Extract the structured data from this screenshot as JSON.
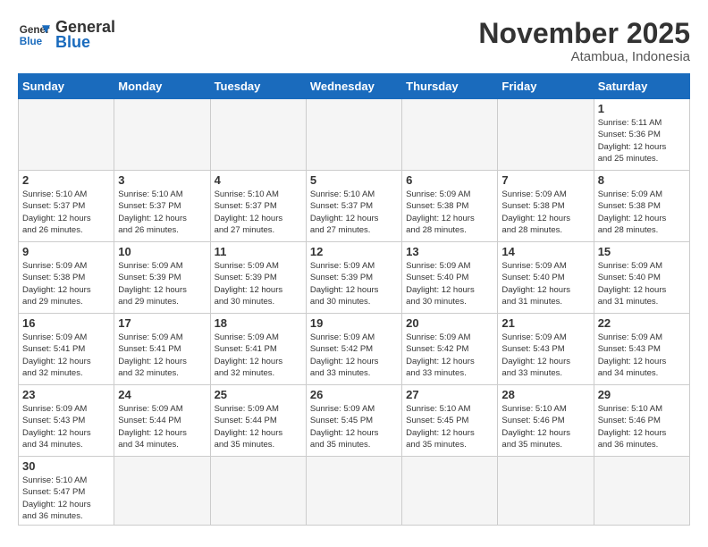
{
  "logo": {
    "text_general": "General",
    "text_blue": "Blue"
  },
  "title": "November 2025",
  "subtitle": "Atambua, Indonesia",
  "weekdays": [
    "Sunday",
    "Monday",
    "Tuesday",
    "Wednesday",
    "Thursday",
    "Friday",
    "Saturday"
  ],
  "weeks": [
    [
      {
        "day": "",
        "empty": true
      },
      {
        "day": "",
        "empty": true
      },
      {
        "day": "",
        "empty": true
      },
      {
        "day": "",
        "empty": true
      },
      {
        "day": "",
        "empty": true
      },
      {
        "day": "",
        "empty": true
      },
      {
        "day": "1",
        "sunrise": "5:11 AM",
        "sunset": "5:36 PM",
        "daylight": "12 hours and 25 minutes."
      }
    ],
    [
      {
        "day": "2",
        "sunrise": "5:10 AM",
        "sunset": "5:37 PM",
        "daylight": "12 hours and 26 minutes."
      },
      {
        "day": "3",
        "sunrise": "5:10 AM",
        "sunset": "5:37 PM",
        "daylight": "12 hours and 26 minutes."
      },
      {
        "day": "4",
        "sunrise": "5:10 AM",
        "sunset": "5:37 PM",
        "daylight": "12 hours and 27 minutes."
      },
      {
        "day": "5",
        "sunrise": "5:10 AM",
        "sunset": "5:37 PM",
        "daylight": "12 hours and 27 minutes."
      },
      {
        "day": "6",
        "sunrise": "5:09 AM",
        "sunset": "5:38 PM",
        "daylight": "12 hours and 28 minutes."
      },
      {
        "day": "7",
        "sunrise": "5:09 AM",
        "sunset": "5:38 PM",
        "daylight": "12 hours and 28 minutes."
      },
      {
        "day": "8",
        "sunrise": "5:09 AM",
        "sunset": "5:38 PM",
        "daylight": "12 hours and 28 minutes."
      }
    ],
    [
      {
        "day": "9",
        "sunrise": "5:09 AM",
        "sunset": "5:38 PM",
        "daylight": "12 hours and 29 minutes."
      },
      {
        "day": "10",
        "sunrise": "5:09 AM",
        "sunset": "5:39 PM",
        "daylight": "12 hours and 29 minutes."
      },
      {
        "day": "11",
        "sunrise": "5:09 AM",
        "sunset": "5:39 PM",
        "daylight": "12 hours and 30 minutes."
      },
      {
        "day": "12",
        "sunrise": "5:09 AM",
        "sunset": "5:39 PM",
        "daylight": "12 hours and 30 minutes."
      },
      {
        "day": "13",
        "sunrise": "5:09 AM",
        "sunset": "5:40 PM",
        "daylight": "12 hours and 30 minutes."
      },
      {
        "day": "14",
        "sunrise": "5:09 AM",
        "sunset": "5:40 PM",
        "daylight": "12 hours and 31 minutes."
      },
      {
        "day": "15",
        "sunrise": "5:09 AM",
        "sunset": "5:40 PM",
        "daylight": "12 hours and 31 minutes."
      }
    ],
    [
      {
        "day": "16",
        "sunrise": "5:09 AM",
        "sunset": "5:41 PM",
        "daylight": "12 hours and 32 minutes."
      },
      {
        "day": "17",
        "sunrise": "5:09 AM",
        "sunset": "5:41 PM",
        "daylight": "12 hours and 32 minutes."
      },
      {
        "day": "18",
        "sunrise": "5:09 AM",
        "sunset": "5:41 PM",
        "daylight": "12 hours and 32 minutes."
      },
      {
        "day": "19",
        "sunrise": "5:09 AM",
        "sunset": "5:42 PM",
        "daylight": "12 hours and 33 minutes."
      },
      {
        "day": "20",
        "sunrise": "5:09 AM",
        "sunset": "5:42 PM",
        "daylight": "12 hours and 33 minutes."
      },
      {
        "day": "21",
        "sunrise": "5:09 AM",
        "sunset": "5:43 PM",
        "daylight": "12 hours and 33 minutes."
      },
      {
        "day": "22",
        "sunrise": "5:09 AM",
        "sunset": "5:43 PM",
        "daylight": "12 hours and 34 minutes."
      }
    ],
    [
      {
        "day": "23",
        "sunrise": "5:09 AM",
        "sunset": "5:43 PM",
        "daylight": "12 hours and 34 minutes."
      },
      {
        "day": "24",
        "sunrise": "5:09 AM",
        "sunset": "5:44 PM",
        "daylight": "12 hours and 34 minutes."
      },
      {
        "day": "25",
        "sunrise": "5:09 AM",
        "sunset": "5:44 PM",
        "daylight": "12 hours and 35 minutes."
      },
      {
        "day": "26",
        "sunrise": "5:09 AM",
        "sunset": "5:45 PM",
        "daylight": "12 hours and 35 minutes."
      },
      {
        "day": "27",
        "sunrise": "5:10 AM",
        "sunset": "5:45 PM",
        "daylight": "12 hours and 35 minutes."
      },
      {
        "day": "28",
        "sunrise": "5:10 AM",
        "sunset": "5:46 PM",
        "daylight": "12 hours and 35 minutes."
      },
      {
        "day": "29",
        "sunrise": "5:10 AM",
        "sunset": "5:46 PM",
        "daylight": "12 hours and 36 minutes."
      }
    ],
    [
      {
        "day": "30",
        "sunrise": "5:10 AM",
        "sunset": "5:47 PM",
        "daylight": "12 hours and 36 minutes."
      },
      {
        "day": "",
        "empty": true
      },
      {
        "day": "",
        "empty": true
      },
      {
        "day": "",
        "empty": true
      },
      {
        "day": "",
        "empty": true
      },
      {
        "day": "",
        "empty": true
      },
      {
        "day": "",
        "empty": true
      }
    ]
  ],
  "labels": {
    "sunrise": "Sunrise:",
    "sunset": "Sunset:",
    "daylight": "Daylight:"
  }
}
